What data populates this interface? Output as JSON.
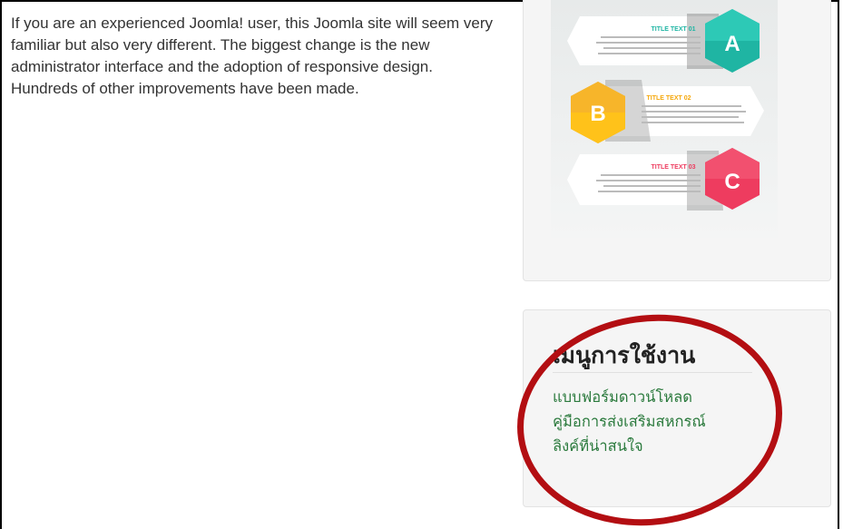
{
  "article": {
    "intro": "If you are an experienced Joomla! user, this Joomla site will seem very familiar but also very different. The biggest change is the new administrator interface and the adoption of responsive design. Hundreds of other improvements have been made."
  },
  "banner": {
    "items": [
      {
        "title": "TITLE TEXT 01",
        "letter": "A",
        "color": "#1fb5a3"
      },
      {
        "title": "TITLE TEXT 02",
        "letter": "B",
        "color": "#f5a70a"
      },
      {
        "title": "TITLE TEXT 03",
        "letter": "C",
        "color": "#ee3c5f"
      }
    ]
  },
  "menu_module": {
    "title": "เมนูการใช้งาน",
    "links": [
      {
        "label": "แบบฟอร์มดาวน์โหลด"
      },
      {
        "label": "คู่มือการส่งเสริมสหกรณ์"
      },
      {
        "label": "ลิงค์ที่น่าสนใจ"
      }
    ]
  },
  "annotation": {
    "color": "#b30e12"
  }
}
